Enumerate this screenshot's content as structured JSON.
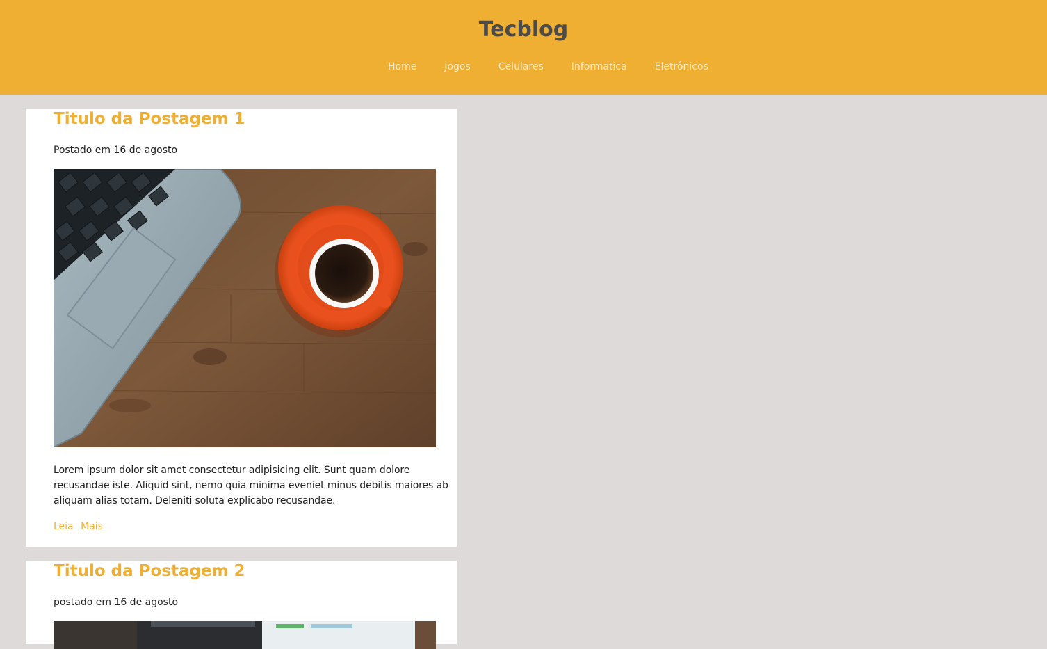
{
  "header": {
    "site_title": "Tecblog",
    "nav": [
      "Home",
      "Jogos",
      "Celulares",
      "Informatica",
      "Eletrônicos"
    ]
  },
  "posts": [
    {
      "title": "Titulo da Postagem 1",
      "meta": "Postado em 16 de agosto",
      "image": "laptop-and-coffee-cup-photo",
      "excerpt": "Lorem ipsum dolor sit amet consectetur adipisicing elit. Sunt quam dolore recusandae iste. Aliquid sint, nemo quia minima eveniet minus debitis maiores ab aliquam alias totam. Deleniti soluta explicabo recusandae.",
      "read_more": "Leia Mais"
    },
    {
      "title": "Titulo da Postagem 2",
      "meta": "postado em 16 de agosto",
      "image": "desk-computer-photo"
    }
  ],
  "colors": {
    "header_bg": "#efaf33",
    "page_bg": "#dfdada",
    "accent": "#efaf33",
    "title_text": "#4b4b4b"
  }
}
